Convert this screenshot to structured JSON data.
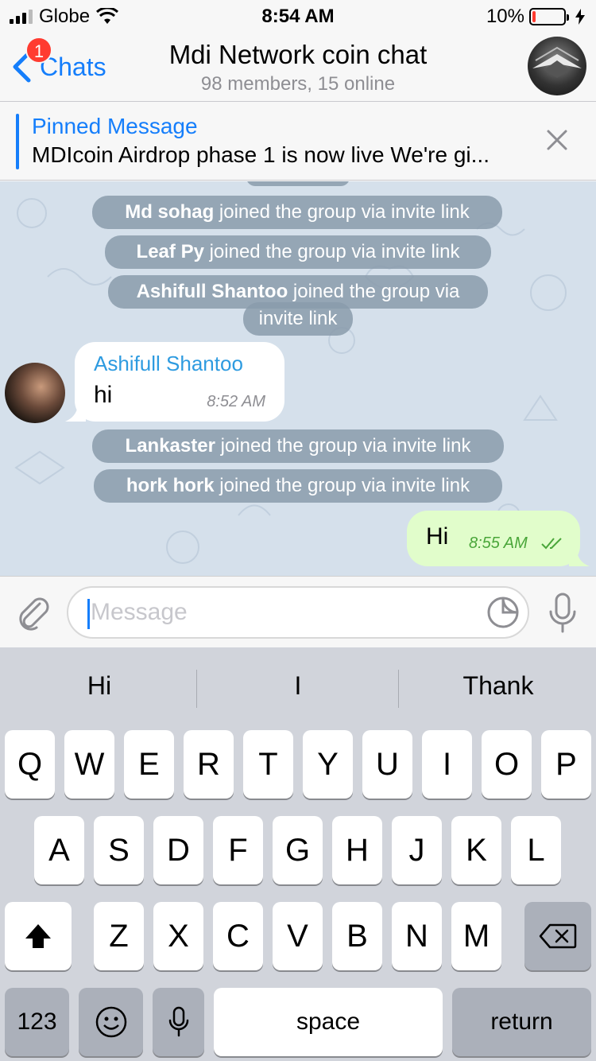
{
  "status_bar": {
    "carrier": "Globe",
    "time": "8:54 AM",
    "battery": "10%"
  },
  "nav": {
    "back_label": "Chats",
    "badge": "1",
    "title": "Mdi Network coin chat",
    "subtitle": "98 members, 15 online"
  },
  "pinned": {
    "title": "Pinned Message",
    "text": "MDIcoin Airdrop phase 1 is now live We're gi..."
  },
  "chat": {
    "service_messages": [
      {
        "name": "Md sohag",
        "text": " joined the group via invite link"
      },
      {
        "name": "Leaf Py",
        "text": " joined the group via invite link"
      },
      {
        "name": "Ashifull Shantoo",
        "text": " joined the group via",
        "line2": "invite link"
      },
      {
        "name": "Lankaster",
        "text": " joined the group via invite link"
      },
      {
        "name": "hork hork",
        "text": " joined the group via invite link"
      }
    ],
    "incoming": {
      "sender": "Ashifull Shantoo",
      "text": "hi",
      "time": "8:52 AM"
    },
    "outgoing": {
      "text": "Hi",
      "time": "8:55 AM"
    }
  },
  "input": {
    "placeholder": "Message"
  },
  "keyboard": {
    "suggestions": [
      "Hi",
      "I",
      "Thank"
    ],
    "row1": [
      "Q",
      "W",
      "E",
      "R",
      "T",
      "Y",
      "U",
      "I",
      "O",
      "P"
    ],
    "row2": [
      "A",
      "S",
      "D",
      "F",
      "G",
      "H",
      "J",
      "K",
      "L"
    ],
    "row3": [
      "Z",
      "X",
      "C",
      "V",
      "B",
      "N",
      "M"
    ],
    "numbers": "123",
    "space": "space",
    "return": "return"
  },
  "colors": {
    "accent": "#157efb",
    "chat_bg": "#d5e0eb",
    "outgoing_bubble": "#e1fdcb",
    "badge": "#ff3b30"
  }
}
